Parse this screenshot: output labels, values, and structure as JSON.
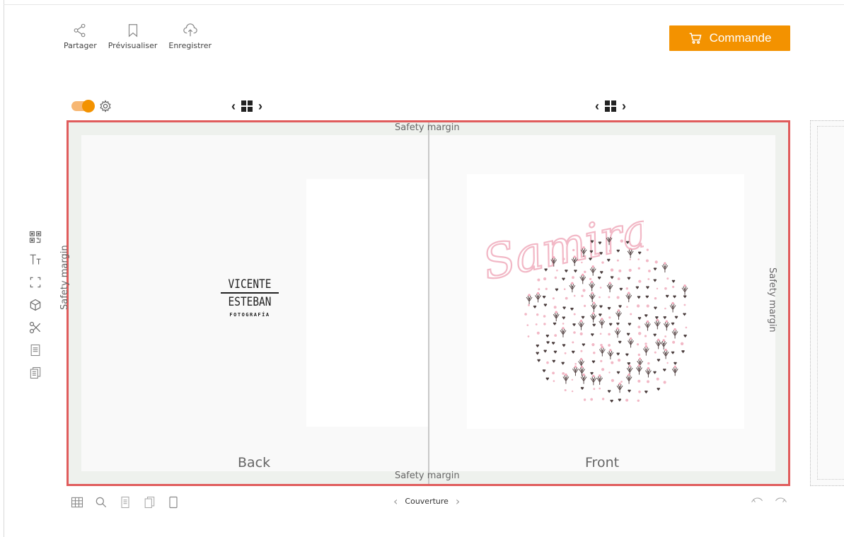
{
  "toolbar": {
    "share_label": "Partager",
    "preview_label": "Prévisualiser",
    "save_label": "Enregistrer"
  },
  "order_button": {
    "label": "Commande"
  },
  "canvas": {
    "safety_margin_label": "Safety margin",
    "back_label": "Back",
    "front_label": "Front"
  },
  "back_logo": {
    "line1": "VICENTE",
    "line2": "ESTEBAN",
    "line3": "FOTOGRAFÍA"
  },
  "front_design": {
    "name": "Samira"
  },
  "bottom_nav": {
    "page_label": "Couverture"
  },
  "colors": {
    "accent": "#f39200",
    "canvas_border": "#e05c5c",
    "samira_pink": "#f2b8c6"
  },
  "icons": {
    "share": "share-icon",
    "preview": "bookmark-icon",
    "save": "cloud-upload-icon",
    "cart": "cart-icon",
    "qr": "qr-code-icon",
    "text": "text-icon",
    "frame": "frame-icon",
    "cube": "cube-icon",
    "cut": "scissors-icon",
    "page": "page-icon",
    "pages": "pages-icon"
  }
}
